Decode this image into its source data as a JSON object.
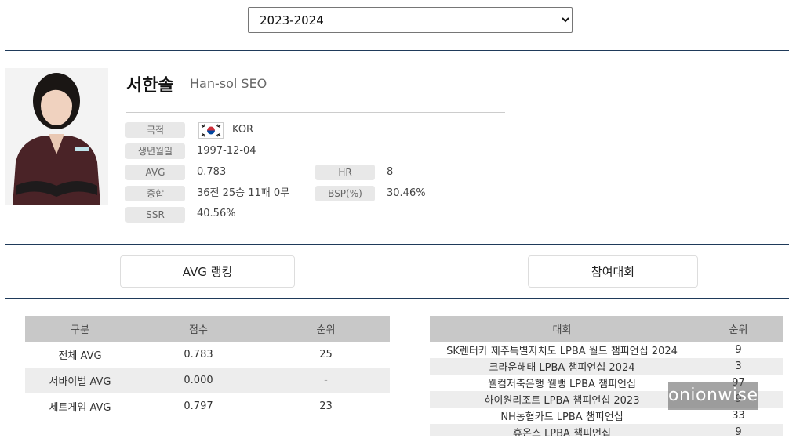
{
  "season": {
    "selected": "2023-2024"
  },
  "player": {
    "name_kr": "서한솔",
    "name_en": "Han-sol SEO",
    "fields": {
      "nationality_label": "국적",
      "nationality": "KOR",
      "birth_label": "생년월일",
      "birth": "1997-12-04",
      "avg_label": "AVG",
      "avg": "0.783",
      "hr_label": "HR",
      "hr": "8",
      "record_label": "종합",
      "record": "36전 25승 11패 0무",
      "bsp_label": "BSP(%)",
      "bsp": "30.46%",
      "ssr_label": "SSR",
      "ssr": "40.56%"
    }
  },
  "buttons": {
    "avg_ranking": "AVG 랭킹",
    "tournaments": "참여대회"
  },
  "avg_table": {
    "headers": [
      "구분",
      "점수",
      "순위"
    ],
    "rows": [
      [
        "전체 AVG",
        "0.783",
        "25"
      ],
      [
        "서바이벌 AVG",
        "0.000",
        "-"
      ],
      [
        "세트게임 AVG",
        "0.797",
        "23"
      ]
    ]
  },
  "tour_table": {
    "headers": [
      "대회",
      "순위"
    ],
    "rows": [
      [
        "SK렌터카 제주특별자치도 LPBA 월드 챔피언십 2024",
        "9"
      ],
      [
        "크라운해태 LPBA 챔피언십 2024",
        "3"
      ],
      [
        "웰컴저축은행 웰뱅 LPBA 챔피언십",
        "97"
      ],
      [
        "하이원리조트 LPBA 챔피언십 2023",
        "9"
      ],
      [
        "NH농협카드 LPBA 챔피언십",
        "33"
      ],
      [
        "휴온스 LPBA 챔피언십",
        "9"
      ]
    ]
  },
  "watermark": "onionwise"
}
